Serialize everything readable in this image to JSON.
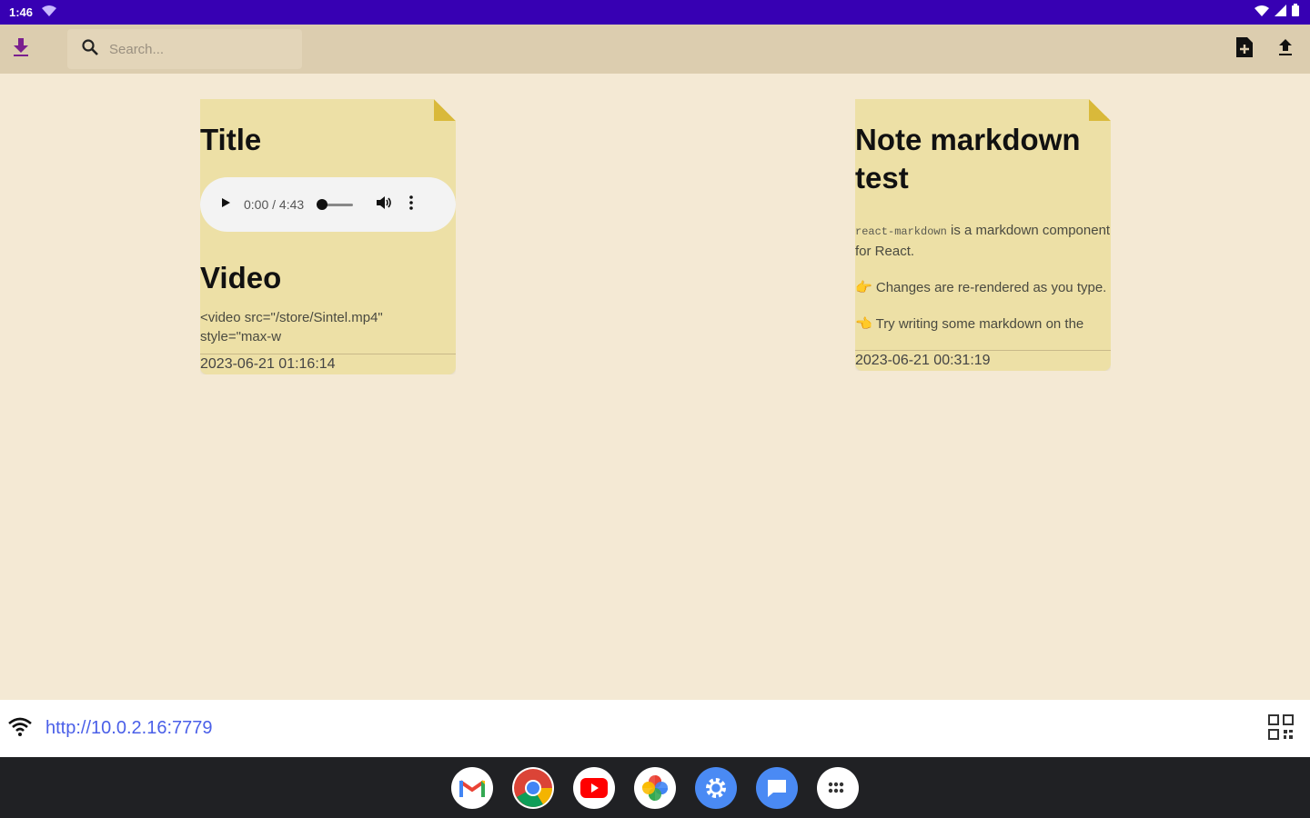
{
  "status_bar": {
    "time": "1:46",
    "icons": [
      "wifi-icon",
      "signal-icon",
      "battery-icon"
    ]
  },
  "toolbar": {
    "search": {
      "placeholder": "Search...",
      "value": ""
    },
    "icons": [
      "download-icon",
      "search-icon",
      "new-note-icon",
      "upload-icon"
    ]
  },
  "notes": [
    {
      "title": "Title",
      "audio": {
        "time": "0:00 / 4:43"
      },
      "heading2": "Video",
      "body": "<video src=\"/store/Sintel.mp4\" style=\"max-w",
      "timestamp": "2023-06-21 01:16:14"
    },
    {
      "title": "Note markdown test",
      "code": "react-markdown",
      "line1_rest": " is a markdown component for React.",
      "line2_emoji": "👉",
      "line2": " Changes are re-rendered as you type.",
      "line3_emoji": "👈",
      "line3": " Try writing some markdown on the",
      "timestamp": "2023-06-21 00:31:19"
    }
  ],
  "url_bar": {
    "url": "http://10.0.2.16:7779",
    "icons": [
      "wifi-icon",
      "qr-code-icon"
    ]
  },
  "dock": {
    "apps": [
      "gmail-icon",
      "chrome-icon",
      "youtube-icon",
      "photos-icon",
      "settings-icon",
      "messages-icon",
      "app-drawer-icon"
    ]
  },
  "colors": {
    "status_bar": "#3700b3",
    "toolbar": "#dccdaf",
    "background": "#f4e9d4",
    "note": "#ede0a6",
    "note_fold": "#d9b93a",
    "link": "#4a5fe8",
    "download_icon": "#7a1f8f"
  }
}
